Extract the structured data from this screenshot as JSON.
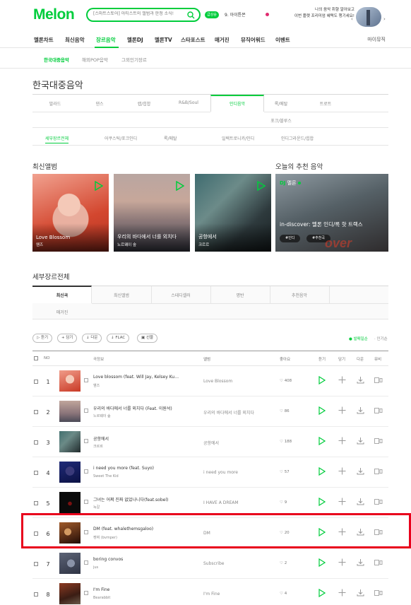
{
  "header": {
    "logo": "Melon",
    "search": {
      "placeholder": "[스마트스토어] 아티스트의 앨범과 한정 소식!"
    },
    "badge": "급상승",
    "rank_text": "9. 아이튠몬",
    "promo_line1": "나의 음악 취향 알아보고",
    "promo_line2": "이번 플랫 프리미엄 혜택도 챙기세요!",
    "prev": "‹",
    "next": "›"
  },
  "gnb": {
    "items": [
      "멜론차트",
      "최신음악",
      "장르음악",
      "멜론DJ",
      "멜론TV",
      "스타포스트",
      "매거진",
      "뮤직어워드",
      "이벤트"
    ],
    "active_index": 2,
    "mymusic": "마이뮤직"
  },
  "subnav": {
    "items": [
      "한국대중음악",
      "해외POP음악",
      "그외인기장르"
    ],
    "active_index": 0
  },
  "page_title": "한국대중음악",
  "genres": {
    "row1": [
      "발라드",
      "댄스",
      "랩/힙합",
      "R&B/Soul",
      "인디음악",
      "록/메탈",
      "트로트"
    ],
    "row2": [
      "포크/블루스"
    ],
    "active": "인디음악"
  },
  "subgenres": {
    "items": [
      "세부장르전체",
      "어쿠스틱/포크인디",
      "록/메탈",
      "일렉트로니카/인디",
      "인디그라운드/힙합"
    ],
    "active_index": 0
  },
  "latest": {
    "title": "최신앨범",
    "albums": [
      {
        "title": "Love Blossom",
        "artist": "웬즈"
      },
      {
        "title": "우리의 바다에서 너를 외치다",
        "artist": "노르웨이 숲"
      },
      {
        "title": "공항에서",
        "artist": "크르르"
      }
    ]
  },
  "recommend": {
    "title": "오늘의 추천 음악",
    "dj_prefix": "DJ",
    "dj_name": "멜론",
    "headline": "in-discover: 멜론 인디/록 핫 트랙스",
    "tag1": "#인디",
    "tag2": "#추천곡"
  },
  "detail": {
    "title": "세부장르전체",
    "tabs_row1": [
      "최신곡",
      "최신앨범",
      "스테디셀러",
      "명반",
      "추천음악"
    ],
    "tabs_row2": [
      "매거진"
    ],
    "active_index": 0
  },
  "toolbar": {
    "buttons": [
      "듣기",
      "담기",
      "다운",
      "FLAC",
      "선물"
    ],
    "sort_latest": "발매일순",
    "sort_popular": "인기순"
  },
  "table": {
    "headers": {
      "no": "NO",
      "song": "곡정보",
      "album": "앨범",
      "like": "좋아요",
      "listen": "듣기",
      "add": "담기",
      "download": "다운",
      "mv": "뮤비"
    },
    "rows": [
      {
        "num": "1",
        "title": "Love blossom (feat. Will Jay, Kelsey Kuan)",
        "artist": "웬즈",
        "album": "Love Blossom",
        "likes": "408"
      },
      {
        "num": "2",
        "title": "우리의 바다에서 너를 외치다 (Feat. 이원석)",
        "artist": "노르웨이 숲",
        "album": "우리의 바다에서 너를 외치다",
        "likes": "86"
      },
      {
        "num": "3",
        "title": "공항에서",
        "artist": "크르르",
        "album": "공항에서",
        "likes": "188"
      },
      {
        "num": "4",
        "title": "i need you more (feat. Suyo)",
        "artist": "Sweet The Kid",
        "album": "i need you more",
        "likes": "57"
      },
      {
        "num": "5",
        "title": "그녀는 어쩌 진짜 없었나니다(feat.sobel)",
        "artist": "녹갈",
        "album": "I HAVE A DREAM",
        "likes": "9"
      },
      {
        "num": "6",
        "title": "DM (feat. whalethemsgaloo)",
        "artist": "켕찌 (bvmper)",
        "album": "DM",
        "likes": "20"
      },
      {
        "num": "7",
        "title": "boring convos",
        "artist": "jus",
        "album": "Subscribe",
        "likes": "2"
      },
      {
        "num": "8",
        "title": "I'm Fine",
        "artist": "Bearabbit",
        "album": "I'm Fine",
        "likes": "4"
      }
    ],
    "highlighted_row": 6
  },
  "colors": {
    "brand": "#00cd3c",
    "highlight": "#e8001c",
    "text": "#333333"
  }
}
